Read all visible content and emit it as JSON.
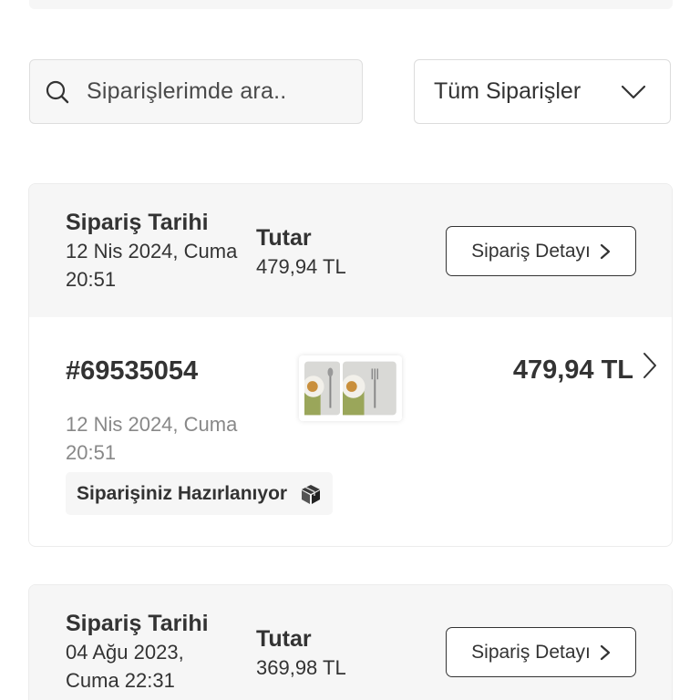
{
  "search": {
    "placeholder": "Siparişlerimde ara.."
  },
  "filter": {
    "selected": "Tüm Siparişler"
  },
  "orders": [
    {
      "date_title": "Sipariş Tarihi",
      "date_line1": "12 Nis 2024, Cuma",
      "date_line2": "20:51",
      "amount_title": "Tutar",
      "amount": "479,94 TL",
      "detail_label": "Sipariş Detayı",
      "order_number": "#69535054",
      "body_date_line1": "12 Nis 2024, Cuma",
      "body_date_line2": "20:51",
      "status": "Siparişiniz Hazırlanıyor",
      "status_icon": "package-icon",
      "body_amount": "479,94 TL"
    },
    {
      "date_title": "Sipariş Tarihi",
      "date_line1": "04 Ağu 2023,",
      "date_line2": "Cuma 22:31",
      "amount_title": "Tutar",
      "amount": "369,98 TL",
      "detail_label": "Sipariş Detayı"
    }
  ],
  "colors": {
    "text": "#333333",
    "muted": "#888888",
    "panel": "#f6f6f6",
    "border": "#dedede"
  }
}
